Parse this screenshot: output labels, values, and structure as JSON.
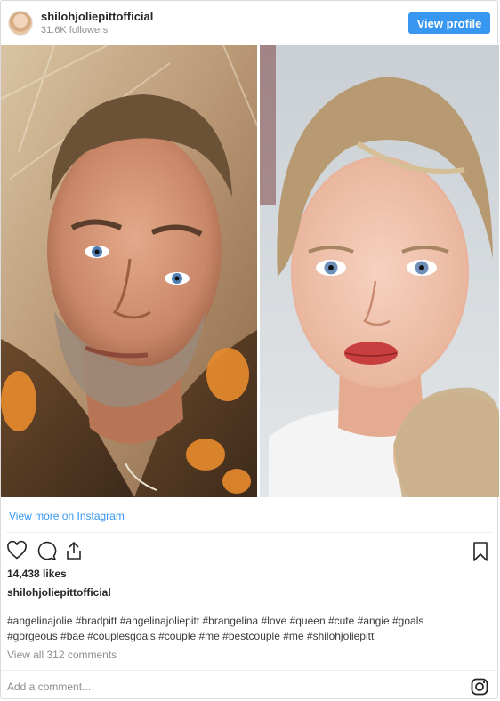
{
  "header": {
    "username": "shilohjoliepittofficial",
    "followers": "31.6K followers",
    "view_profile_label": "View profile"
  },
  "media": {
    "left_photo": "man-portrait",
    "right_photo": "child-portrait"
  },
  "view_more_link": "View more on Instagram",
  "actions": {
    "icons": [
      "heart-icon",
      "comment-icon",
      "share-icon",
      "bookmark-icon"
    ]
  },
  "likes": "14,438 likes",
  "caption": {
    "username": "shilohjoliepittofficial",
    "hashtags_line1": "#angelinajolie #bradpitt #angelinajoliepitt #brangelina #love #queen #cute #angie #goals",
    "hashtags_line2": "#gorgeous #bae #couplesgoals #couple #me #bestcouple #me #shilohjoliepitt"
  },
  "view_all_comments": "View all 312 comments",
  "comment": {
    "placeholder": "Add a comment..."
  },
  "colors": {
    "accent": "#3897f0",
    "text": "#262626",
    "muted": "#8e8e8e",
    "border": "#dbdbdb"
  }
}
